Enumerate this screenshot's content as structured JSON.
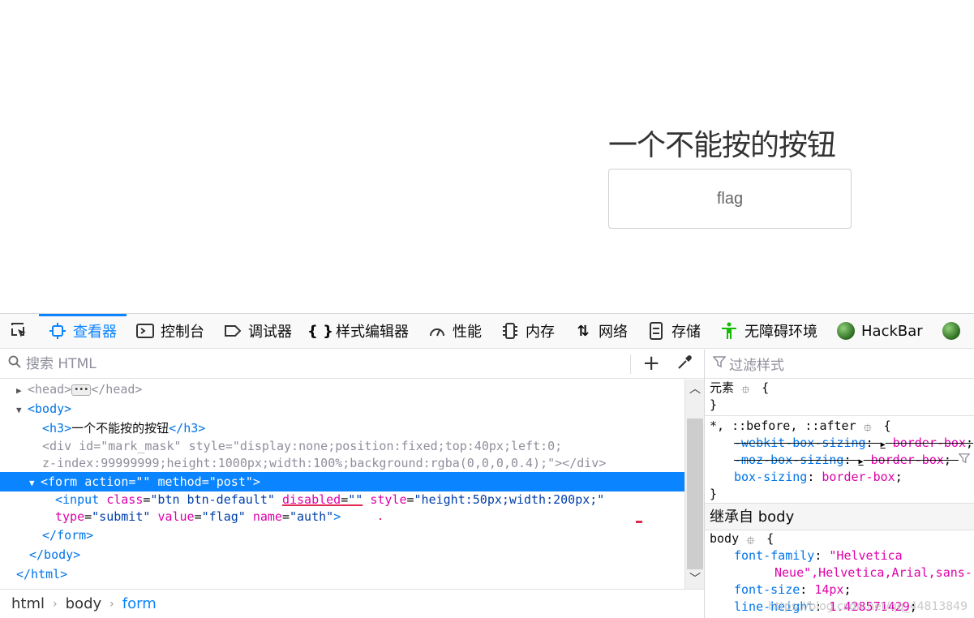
{
  "preview": {
    "heading": "一个不能按的按钮",
    "button_value": "flag"
  },
  "toolbar": {
    "tabs": [
      {
        "label": "查看器",
        "icon": "inspector-icon"
      },
      {
        "label": "控制台",
        "icon": "console-icon"
      },
      {
        "label": "调试器",
        "icon": "debugger-icon"
      },
      {
        "label": "样式编辑器",
        "icon": "style-editor-icon"
      },
      {
        "label": "性能",
        "icon": "performance-icon"
      },
      {
        "label": "内存",
        "icon": "memory-icon"
      },
      {
        "label": "网络",
        "icon": "network-icon"
      },
      {
        "label": "存储",
        "icon": "storage-icon"
      },
      {
        "label": "无障碍环境",
        "icon": "accessibility-icon"
      },
      {
        "label": "HackBar",
        "icon": "hackbar-icon"
      }
    ],
    "active_tab": "查看器"
  },
  "markup": {
    "search_placeholder": "搜索 HTML",
    "head_open": "<head>",
    "head_close": "</head>",
    "body_open": "<body>",
    "h3_open": "<h3>",
    "h3_text": "一个不能按的按钮",
    "h3_close": "</h3>",
    "div_tag": "<div",
    "div_id_attr": "id",
    "div_id_val": "\"mark_mask\"",
    "div_style_attr": "style",
    "div_style_val1": "\"display:none;position:fixed;top:40px;left:0;",
    "div_style_val2": "z-index:99999999;height:1000px;width:100%;background:rgba(0,0,0,0.4);\"",
    "div_close": "></div>",
    "form_tag": "<form",
    "form_action_attr": "action",
    "form_action_val": "\"\"",
    "form_method_attr": "method",
    "form_method_val": "\"post\"",
    "form_gt": ">",
    "input_tag": "<input",
    "input_class_attr": "class",
    "input_class_val": "\"btn btn-default\"",
    "input_disabled_attr": "disabled",
    "input_disabled_val": "\"\"",
    "input_style_attr": "style",
    "input_style_val": "\"height:50px;width:200px;\"",
    "input_type_attr": "type",
    "input_type_val": "\"submit\"",
    "input_value_attr": "value",
    "input_value_val": "\"flag\"",
    "input_name_attr": "name",
    "input_name_val": "\"auth\"",
    "input_gt": ">",
    "form_close": "</form>",
    "body_close": "</body>",
    "html_close": "</html>"
  },
  "breadcrumbs": [
    "html",
    "body",
    "form"
  ],
  "rules": {
    "filter_placeholder": "过滤样式",
    "element_selector": "元素",
    "universal_selector": "*, ::before, ::after",
    "src_letter": "b",
    "webkit_prop": "-webkit-box-sizing",
    "webkit_val": "border-box",
    "moz_prop": "-moz-box-sizing",
    "moz_val": "border-box",
    "box_prop": "box-sizing",
    "box_val": "border-box",
    "inherited_label": "继承自 body",
    "body_selector": "body",
    "font_family_prop": "font-family",
    "font_family_val1": "\"Helvetica",
    "font_family_val2": "Neue\",Helvetica,Arial,sans-",
    "font_size_prop": "font-size",
    "font_size_val": "14px",
    "line_height_prop": "line-height",
    "line_height_val": "1.428571429"
  },
  "watermark": "https://blog.csdn.net/qq_44813849",
  "colors": {
    "accent": "#0a84ff",
    "tag": "#0074e8",
    "attr": "#dd00a9",
    "annotation_red": "#e22850"
  }
}
